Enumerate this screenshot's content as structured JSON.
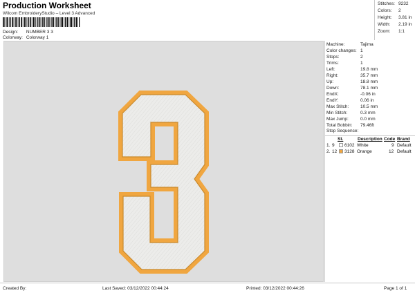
{
  "header": {
    "title": "Production Worksheet",
    "subtitle": "Wilcom EmbroideryStudio – Level 3 Advanced",
    "design_label": "Design:",
    "design_value": "NUMBER 3 3",
    "colorway_label": "Colorway:",
    "colorway_value": "Colorway 1"
  },
  "stats": {
    "stitches_label": "Stitches:",
    "stitches_value": "9232",
    "colors_label": "Colors:",
    "colors_value": "2",
    "height_label": "Height:",
    "height_value": "3.81 in",
    "width_label": "Width:",
    "width_value": "2.19 in",
    "zoom_label": "Zoom:",
    "zoom_value": "1:1"
  },
  "info": {
    "machine_label": "Machine:",
    "machine_value": "Tajima",
    "color_changes_label": "Color changes:",
    "color_changes_value": "1",
    "stops_label": "Stops:",
    "stops_value": "2",
    "trims_label": "Trims:",
    "trims_value": "1",
    "left_label": "Left:",
    "left_value": "19.8 mm",
    "right_label": "Right:",
    "right_value": "35.7 mm",
    "up_label": "Up:",
    "up_value": "18.8 mm",
    "down_label": "Down:",
    "down_value": "78.1 mm",
    "endx_label": "EndX:",
    "endx_value": "-0.06 in",
    "endy_label": "EndY:",
    "endy_value": "0.06 in",
    "max_stitch_label": "Max Stitch:",
    "max_stitch_value": "10.5 mm",
    "min_stitch_label": "Min Stitch:",
    "min_stitch_value": "0.3 mm",
    "max_jump_label": "Max Jump:",
    "max_jump_value": "0.0 mm",
    "total_bobbin_label": "Total Bobbin:",
    "total_bobbin_value": "79.46ft"
  },
  "stop_sequence": {
    "title": "Stop Sequence:",
    "headers": {
      "st": "St.",
      "description": "Description",
      "code": "Code",
      "brand": "Brand"
    },
    "rows": [
      {
        "index": "1.",
        "stitches": "9",
        "code_num": "6102",
        "description": "White",
        "code": "9",
        "brand": "Default",
        "color": "#ffffff"
      },
      {
        "index": "2.",
        "stitches": "12",
        "code_num": "3128",
        "description": "Orange",
        "code": "12",
        "brand": "Default",
        "color": "#f0a640"
      }
    ]
  },
  "design": {
    "fill_color": "#ececea",
    "outline_color": "#f0a640",
    "outline_dark": "#c98a2e"
  },
  "footer": {
    "created_by": "Created By:",
    "last_saved": "Last Saved: 03/12/2022 00:44:24",
    "printed": "Printed: 03/12/2022 00:44:26",
    "page": "Page 1 of 1"
  }
}
